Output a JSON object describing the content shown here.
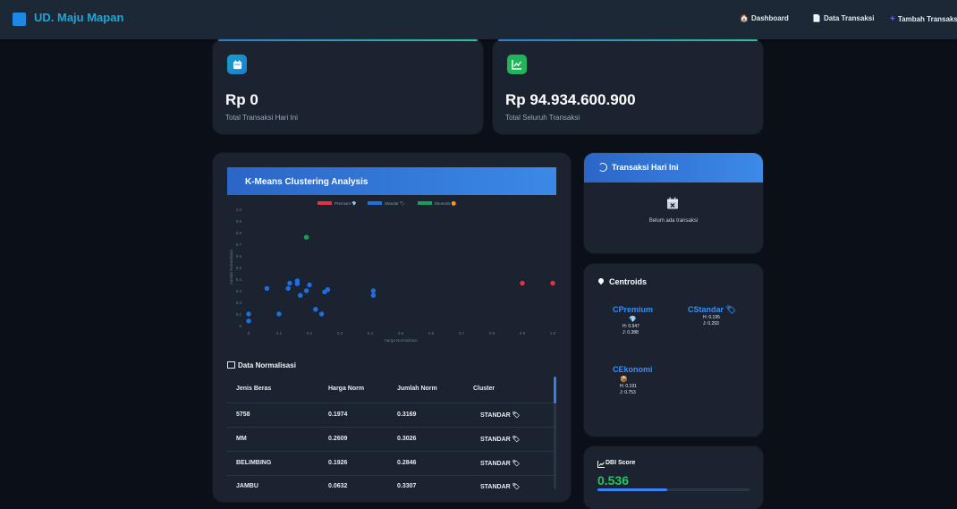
{
  "navbar": {
    "brand": "UD. Maju Mapan",
    "links": [
      {
        "icon": "🏠",
        "label": "Dashboard"
      },
      {
        "icon": "📄",
        "label": "Data Transaksi"
      },
      {
        "icon": "+",
        "label": "Tambah Transaksi"
      }
    ]
  },
  "stats": [
    {
      "icon": "calendar-icon",
      "value": "Rp 0",
      "label": "Total Transaksi Hari Ini",
      "color": "#1ea7d6"
    },
    {
      "icon": "chart-line-icon",
      "value": "Rp 94.934.600.900",
      "label": "Total Seluruh Transaksi",
      "color": "#22b45a"
    }
  ],
  "chart_section": {
    "title": "K-Means Clustering Analysis",
    "normalization_title": "Data Normalisasi"
  },
  "chart_data": {
    "type": "scatter",
    "xlabel": "Harga Normalisasi",
    "ylabel": "Jumlah Normalisasi",
    "xlim": [
      0,
      1
    ],
    "ylim": [
      0,
      1
    ],
    "xticks": [
      "0",
      "0.1",
      "0.2",
      "0.3",
      "0.4",
      "0.5",
      "0.6",
      "0.7",
      "0.8",
      "0.9",
      "1.0"
    ],
    "yticks": [
      "0",
      "0.1",
      "0.2",
      "0.3",
      "0.4",
      "0.5",
      "0.6",
      "0.7",
      "0.8",
      "0.9",
      "1.0"
    ],
    "legend_position": "top",
    "series": [
      {
        "name": "Premium 💎",
        "color": "#dc3545",
        "points": [
          [
            0.9,
            0.365
          ],
          [
            1.0,
            0.365
          ]
        ]
      },
      {
        "name": "Standar 🏷",
        "color": "#1f6fe0",
        "points": [
          [
            0.0,
            0.04
          ],
          [
            0.0,
            0.1
          ],
          [
            0.1,
            0.1
          ],
          [
            0.06,
            0.32
          ],
          [
            0.13,
            0.32
          ],
          [
            0.135,
            0.365
          ],
          [
            0.16,
            0.385
          ],
          [
            0.16,
            0.36
          ],
          [
            0.17,
            0.26
          ],
          [
            0.19,
            0.3
          ],
          [
            0.2,
            0.35
          ],
          [
            0.22,
            0.14
          ],
          [
            0.24,
            0.1
          ],
          [
            0.25,
            0.29
          ],
          [
            0.26,
            0.31
          ],
          [
            0.41,
            0.3
          ],
          [
            0.41,
            0.26
          ]
        ]
      },
      {
        "name": "Ekonomi 🟠",
        "color": "#1e9c59",
        "points": [
          [
            0.19,
            0.76
          ]
        ]
      }
    ]
  },
  "table": {
    "headers": [
      "Jenis Beras",
      "Harga Norm",
      "Jumlah Norm",
      "Cluster"
    ],
    "rows": [
      [
        "5758",
        "0.1974",
        "0.3169",
        "STANDAR 🏷"
      ],
      [
        "MM",
        "0.2609",
        "0.3026",
        "STANDAR 🏷"
      ],
      [
        "BELIMBING",
        "0.1926",
        "0.2846",
        "STANDAR 🏷"
      ],
      [
        "JAMBU",
        "0.0632",
        "0.3307",
        "STANDAR 🏷"
      ]
    ]
  },
  "today": {
    "title": "Transaksi Hari Ini",
    "empty_text": "Belum ada transaksi"
  },
  "centroids": {
    "title": "Centroids",
    "items": [
      {
        "name": "CPremium",
        "icon": "💎",
        "h": "H: 0.947",
        "j": "J: 0.388"
      },
      {
        "name": "CStandar 🏷",
        "icon": "",
        "h": "H: 0.195",
        "j": "J: 0.293"
      },
      {
        "name": "CEkonomi",
        "icon": "📦",
        "h": "H: 0.191",
        "j": "J: 0.753"
      }
    ]
  },
  "dbi": {
    "title": "DBI Score",
    "value": "0.536",
    "progress": 0.46
  }
}
